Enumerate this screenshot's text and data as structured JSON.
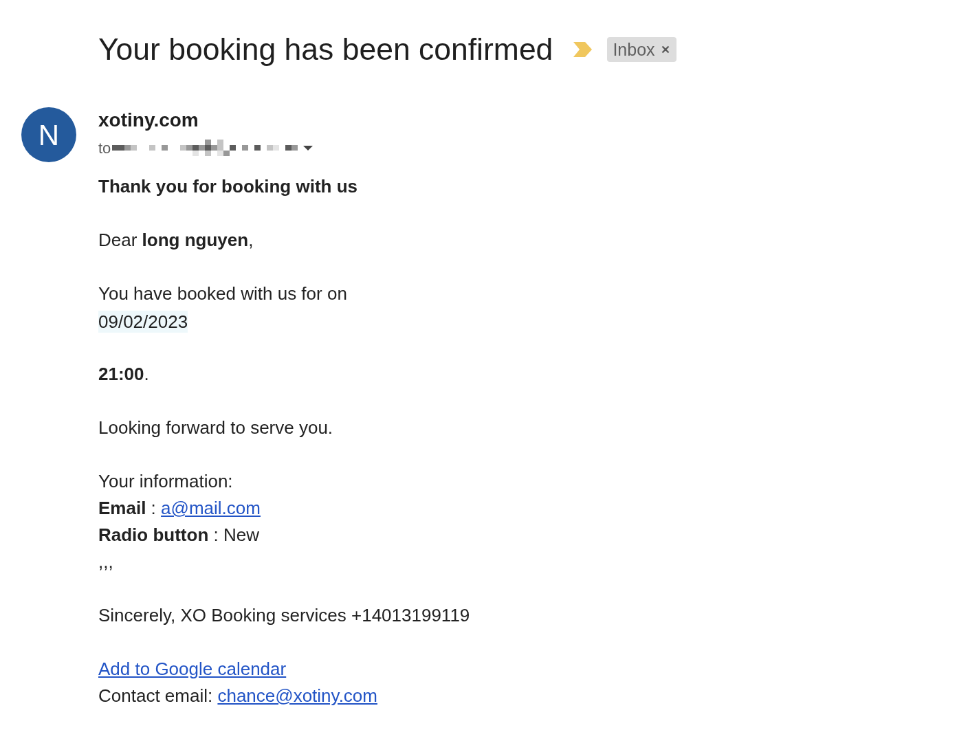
{
  "subject": {
    "title": "Your booking has been confirmed",
    "important": true,
    "labels": [
      {
        "text": "Inbox",
        "removable": true
      }
    ]
  },
  "sender": {
    "avatar_letter": "N",
    "name": "xotiny.com",
    "to_prefix": "to"
  },
  "body": [
    {
      "lines": [
        {
          "kind": "heading",
          "text": "Thank you for booking with us"
        }
      ]
    },
    {
      "lines": [
        {
          "kind": "text",
          "text": "Dear **long nguyen**,"
        }
      ]
    },
    {
      "lines": [
        {
          "kind": "text",
          "text": "You have booked with us for on"
        },
        {
          "kind": "highlight",
          "text": "09/02/2023"
        }
      ]
    },
    {
      "lines": [
        {
          "kind": "text",
          "text": "**21:00**."
        }
      ]
    },
    {
      "lines": [
        {
          "kind": "text",
          "text": "Looking forward to serve you."
        }
      ]
    },
    {
      "lines": [
        {
          "kind": "text",
          "text": "Your information:"
        },
        {
          "kind": "field",
          "label": "Email",
          "separator": ":",
          "value": "a@mail.com",
          "link": true
        },
        {
          "kind": "field",
          "label": "Radio button",
          "separator": ":",
          "value": "New",
          "link": false
        },
        {
          "kind": "text",
          "text": ",,,"
        }
      ]
    },
    {
      "lines": [
        {
          "kind": "text",
          "text": "Sincerely, XO Booking services +14013199119"
        }
      ]
    },
    {
      "lines": [
        {
          "kind": "link",
          "text": "Add to Google calendar"
        },
        {
          "kind": "label_link",
          "text": "Contact email:",
          "link_text": "chance@xotiny.com"
        }
      ]
    }
  ]
}
